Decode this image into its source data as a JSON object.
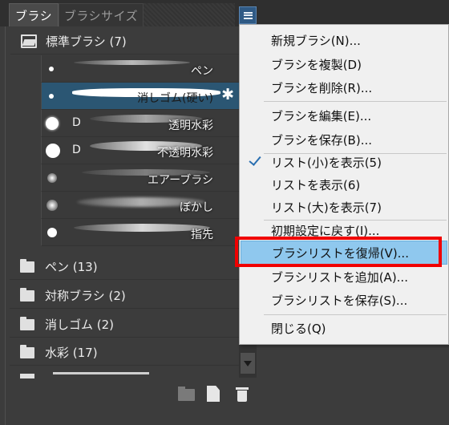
{
  "tabs": {
    "brush": "ブラシ",
    "brush_size": "ブラシサイズ"
  },
  "folders": [
    {
      "label": "標準ブラシ (7)",
      "open": true
    },
    {
      "label": "ペン (13)",
      "open": false
    },
    {
      "label": "対称ブラシ (2)",
      "open": false
    },
    {
      "label": "消しゴム (2)",
      "open": false
    },
    {
      "label": "水彩 (17)",
      "open": false
    }
  ],
  "brushes": [
    {
      "name": "ペン",
      "prefix": "",
      "selected": false
    },
    {
      "name": "消しゴム(硬い)",
      "prefix": "",
      "selected": true
    },
    {
      "name": "透明水彩",
      "prefix": "D",
      "selected": false
    },
    {
      "name": "不透明水彩",
      "prefix": "D",
      "selected": false
    },
    {
      "name": "エアーブラシ",
      "prefix": "",
      "selected": false
    },
    {
      "name": "ぼかし",
      "prefix": "",
      "selected": false
    },
    {
      "name": "指先",
      "prefix": "",
      "selected": false
    }
  ],
  "menu": {
    "new_brush": "新規ブラシ(N)...",
    "duplicate": "ブラシを複製(D)",
    "delete": "ブラシを削除(R)...",
    "edit": "ブラシを編集(E)...",
    "save": "ブラシを保存(B)...",
    "list_small": "リスト(小)を表示(5)",
    "list_normal": "リストを表示(6)",
    "list_large": "リスト(大)を表示(7)",
    "reset": "初期設定に戻す(I)...",
    "restore_list": "ブラシリストを復帰(V)...",
    "add_list": "ブラシリストを追加(A)...",
    "save_list": "ブラシリストを保存(S)...",
    "close": "閉じる(Q)"
  },
  "colors": {
    "accent": "#2b5673",
    "highlight": "#8fc8ee",
    "callout": "#f00000"
  }
}
